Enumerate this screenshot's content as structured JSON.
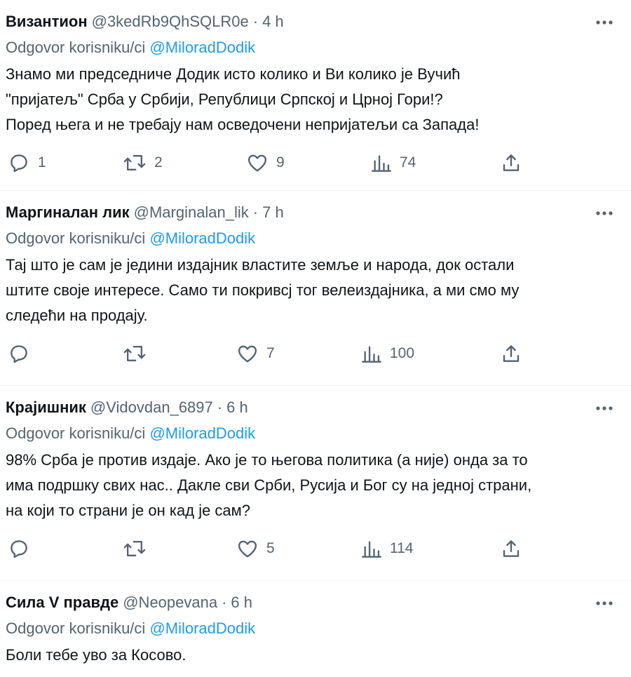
{
  "reply_prefix": "Odgovor korisniku/ci",
  "tweets": [
    {
      "author": "Византион",
      "handle": "@3kedRb9QhSQLR0e",
      "sep": "·",
      "time": "4 h",
      "mention": "@MiloradDodik",
      "text": "Знамо ми председниче Додик исто колико и Ви колико је Вучић\n\"пријатељ\" Срба у Србији, Републици Српској и Црној Гори!?\nПоред њега и не требају нам осведочени непријатељи са Запада!",
      "replies": "1",
      "retweets": "2",
      "likes": "9",
      "views": "74"
    },
    {
      "author": "Маргиналан лик",
      "handle": "@Marginalan_lik",
      "sep": "·",
      "time": "7 h",
      "mention": "@MiloradDodik",
      "text": "Тај што је сам је једини издајник властите земље и народа, док остали\nштите своје интересе. Само ти покривсј тог велеиздајника, а ми смо му\nследећи на продају.",
      "replies": "",
      "retweets": "",
      "likes": "7",
      "views": "100"
    },
    {
      "author": "Крајишник",
      "handle": "@Vidovdan_6897",
      "sep": "·",
      "time": "6 h",
      "mention": "@MiloradDodik",
      "text": "98% Срба је против издаје. Ако је то његова политика (а није) онда за то\nима подршку свих нас.. Дакле сви Срби, Русија и Бог су на једној страни,\nна који то страни је он кад је сам?",
      "replies": "",
      "retweets": "",
      "likes": "5",
      "views": "114"
    },
    {
      "author": "Сила V правде",
      "handle": "@Neopevana",
      "sep": "·",
      "time": "6 h",
      "mention": "@MiloradDodik",
      "text": "Боли тебе уво за Косово.",
      "replies": "",
      "retweets": "",
      "likes": "",
      "views": ""
    }
  ],
  "icons": {
    "reply": "reply-icon",
    "retweet": "retweet-icon",
    "like": "heart-icon",
    "views": "views-icon",
    "share": "share-icon",
    "more": "more-icon"
  },
  "colors": {
    "text": "#0f1419",
    "muted": "#536471",
    "link": "#1d9bf0",
    "divider": "#eff3f4"
  }
}
